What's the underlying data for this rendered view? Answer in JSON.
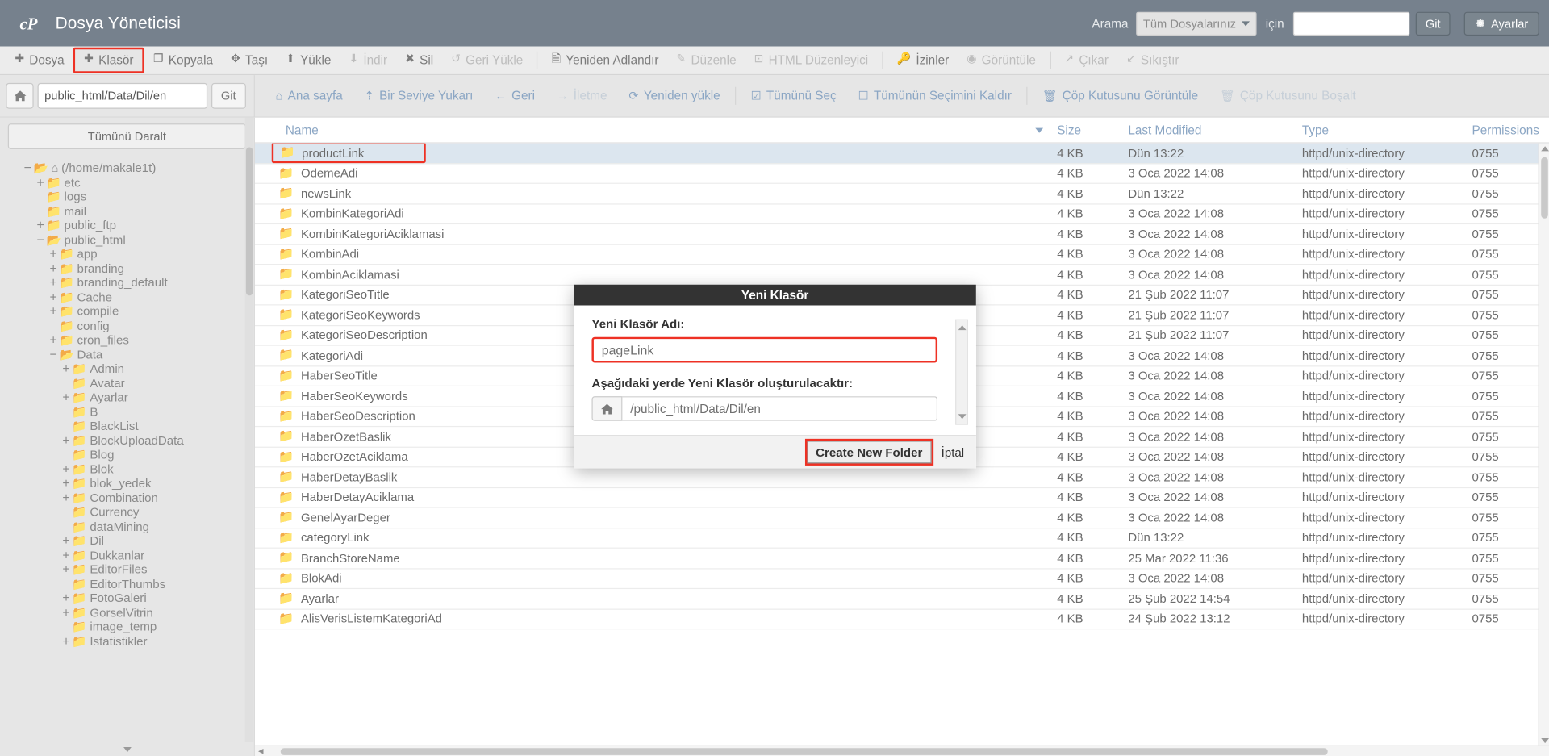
{
  "header": {
    "logo_icon": "cpanel-logo-icon",
    "title": "Dosya Yöneticisi",
    "search_label": "Arama",
    "search_scope_value": "Tüm Dosyalarınız",
    "search_for_label": "için",
    "search_input_value": "",
    "search_input_placeholder": "",
    "go_label": "Git",
    "settings_label": "Ayarlar",
    "settings_icon": "gear-icon"
  },
  "toolbar": [
    {
      "label": "Dosya",
      "icon": "plus-icon",
      "disabled": false,
      "highlight": false
    },
    {
      "label": "Klasör",
      "icon": "plus-icon",
      "disabled": false,
      "highlight": true
    },
    {
      "label": "Kopyala",
      "icon": "copy-icon",
      "disabled": false,
      "highlight": false
    },
    {
      "label": "Taşı",
      "icon": "move-icon",
      "disabled": false,
      "highlight": false
    },
    {
      "label": "Yükle",
      "icon": "upload-icon",
      "disabled": false,
      "highlight": false
    },
    {
      "label": "İndir",
      "icon": "download-icon",
      "disabled": true,
      "highlight": false
    },
    {
      "label": "Sil",
      "icon": "x-icon",
      "disabled": false,
      "highlight": false
    },
    {
      "label": "Geri Yükle",
      "icon": "undo-icon",
      "disabled": true,
      "highlight": false
    },
    {
      "label": "Yeniden Adlandır",
      "icon": "file-icon",
      "disabled": false,
      "highlight": false
    },
    {
      "label": "Düzenle",
      "icon": "pencil-icon",
      "disabled": true,
      "highlight": false
    },
    {
      "label": "HTML Düzenleyici",
      "icon": "code-icon",
      "disabled": true,
      "highlight": false
    },
    {
      "label": "İzinler",
      "icon": "key-icon",
      "disabled": false,
      "highlight": false
    },
    {
      "label": "Görüntüle",
      "icon": "eye-icon",
      "disabled": true,
      "highlight": false
    },
    {
      "label": "Çıkar",
      "icon": "extract-icon",
      "disabled": true,
      "highlight": false
    },
    {
      "label": "Sıkıştır",
      "icon": "compress-icon",
      "disabled": true,
      "highlight": false
    }
  ],
  "pathbar": {
    "home_icon": "home-icon",
    "path_value": "public_html/Data/Dil/en",
    "git_label": "Git"
  },
  "navbar": [
    {
      "label": "Ana sayfa",
      "icon": "home-icon",
      "dim": false
    },
    {
      "label": "Bir Seviye Yukarı",
      "icon": "up-arrow-icon",
      "dim": false
    },
    {
      "label": "Geri",
      "icon": "arrow-left-icon",
      "dim": false
    },
    {
      "label": "İletme",
      "icon": "arrow-right-icon",
      "dim": true
    },
    {
      "label": "Yeniden yükle",
      "icon": "refresh-icon",
      "dim": false
    },
    {
      "label": "Tümünü Seç",
      "icon": "checkbox-checked-icon",
      "dim": false
    },
    {
      "label": "Tümünün Seçimini Kaldır",
      "icon": "checkbox-empty-icon",
      "dim": false
    },
    {
      "label": "Çöp Kutusunu Görüntüle",
      "icon": "trash-icon",
      "dim": false
    },
    {
      "label": "Çöp Kutusunu Boşalt",
      "icon": "trash-icon",
      "dim": true
    }
  ],
  "sidebar": {
    "collapse_label": "Tümünü Daralt",
    "tree": [
      {
        "label": "(/home/makale1t)",
        "indent": 0,
        "toggle": "−",
        "icon": "folder-open-icon",
        "home": true
      },
      {
        "label": "etc",
        "indent": 1,
        "toggle": "+",
        "icon": "folder-icon"
      },
      {
        "label": "logs",
        "indent": 1,
        "toggle": "",
        "icon": "folder-icon"
      },
      {
        "label": "mail",
        "indent": 1,
        "toggle": "",
        "icon": "folder-icon"
      },
      {
        "label": "public_ftp",
        "indent": 1,
        "toggle": "+",
        "icon": "folder-icon"
      },
      {
        "label": "public_html",
        "indent": 1,
        "toggle": "−",
        "icon": "folder-open-icon"
      },
      {
        "label": "app",
        "indent": 2,
        "toggle": "+",
        "icon": "folder-icon"
      },
      {
        "label": "branding",
        "indent": 2,
        "toggle": "+",
        "icon": "folder-icon"
      },
      {
        "label": "branding_default",
        "indent": 2,
        "toggle": "+",
        "icon": "folder-icon"
      },
      {
        "label": "Cache",
        "indent": 2,
        "toggle": "+",
        "icon": "folder-icon"
      },
      {
        "label": "compile",
        "indent": 2,
        "toggle": "+",
        "icon": "folder-icon"
      },
      {
        "label": "config",
        "indent": 2,
        "toggle": "",
        "icon": "folder-icon"
      },
      {
        "label": "cron_files",
        "indent": 2,
        "toggle": "+",
        "icon": "folder-icon"
      },
      {
        "label": "Data",
        "indent": 2,
        "toggle": "−",
        "icon": "folder-open-icon"
      },
      {
        "label": "Admin",
        "indent": 3,
        "toggle": "+",
        "icon": "folder-icon"
      },
      {
        "label": "Avatar",
        "indent": 3,
        "toggle": "",
        "icon": "folder-icon"
      },
      {
        "label": "Ayarlar",
        "indent": 3,
        "toggle": "+",
        "icon": "folder-icon"
      },
      {
        "label": "B",
        "indent": 3,
        "toggle": "",
        "icon": "folder-icon"
      },
      {
        "label": "BlackList",
        "indent": 3,
        "toggle": "",
        "icon": "folder-icon"
      },
      {
        "label": "BlockUploadData",
        "indent": 3,
        "toggle": "+",
        "icon": "folder-icon"
      },
      {
        "label": "Blog",
        "indent": 3,
        "toggle": "",
        "icon": "folder-icon"
      },
      {
        "label": "Blok",
        "indent": 3,
        "toggle": "+",
        "icon": "folder-icon"
      },
      {
        "label": "blok_yedek",
        "indent": 3,
        "toggle": "+",
        "icon": "folder-icon"
      },
      {
        "label": "Combination",
        "indent": 3,
        "toggle": "+",
        "icon": "folder-icon"
      },
      {
        "label": "Currency",
        "indent": 3,
        "toggle": "",
        "icon": "folder-icon"
      },
      {
        "label": "dataMining",
        "indent": 3,
        "toggle": "",
        "icon": "folder-icon"
      },
      {
        "label": "Dil",
        "indent": 3,
        "toggle": "+",
        "icon": "folder-icon"
      },
      {
        "label": "Dukkanlar",
        "indent": 3,
        "toggle": "+",
        "icon": "folder-icon"
      },
      {
        "label": "EditorFiles",
        "indent": 3,
        "toggle": "+",
        "icon": "folder-icon"
      },
      {
        "label": "EditorThumbs",
        "indent": 3,
        "toggle": "",
        "icon": "folder-icon"
      },
      {
        "label": "FotoGaleri",
        "indent": 3,
        "toggle": "+",
        "icon": "folder-icon"
      },
      {
        "label": "GorselVitrin",
        "indent": 3,
        "toggle": "+",
        "icon": "folder-icon"
      },
      {
        "label": "image_temp",
        "indent": 3,
        "toggle": "",
        "icon": "folder-icon"
      },
      {
        "label": "Istatistikler",
        "indent": 3,
        "toggle": "+",
        "icon": "folder-icon"
      }
    ]
  },
  "filelist": {
    "columns": {
      "name": "Name",
      "size": "Size",
      "modified": "Last Modified",
      "type": "Type",
      "permissions": "Permissions"
    },
    "sort": {
      "column": "Name",
      "direction": "desc"
    },
    "rows": [
      {
        "name": "productLink",
        "size": "4 KB",
        "modified": "Dün 13:22",
        "type": "httpd/unix-directory",
        "permissions": "0755",
        "selected": true,
        "highlight": true
      },
      {
        "name": "OdemeAdi",
        "size": "4 KB",
        "modified": "3 Oca 2022 14:08",
        "type": "httpd/unix-directory",
        "permissions": "0755"
      },
      {
        "name": "newsLink",
        "size": "4 KB",
        "modified": "Dün 13:22",
        "type": "httpd/unix-directory",
        "permissions": "0755"
      },
      {
        "name": "KombinKategoriAdi",
        "size": "4 KB",
        "modified": "3 Oca 2022 14:08",
        "type": "httpd/unix-directory",
        "permissions": "0755"
      },
      {
        "name": "KombinKategoriAciklamasi",
        "size": "4 KB",
        "modified": "3 Oca 2022 14:08",
        "type": "httpd/unix-directory",
        "permissions": "0755"
      },
      {
        "name": "KombinAdi",
        "size": "4 KB",
        "modified": "3 Oca 2022 14:08",
        "type": "httpd/unix-directory",
        "permissions": "0755"
      },
      {
        "name": "KombinAciklamasi",
        "size": "4 KB",
        "modified": "3 Oca 2022 14:08",
        "type": "httpd/unix-directory",
        "permissions": "0755"
      },
      {
        "name": "KategoriSeoTitle",
        "size": "4 KB",
        "modified": "21 Şub 2022 11:07",
        "type": "httpd/unix-directory",
        "permissions": "0755"
      },
      {
        "name": "KategoriSeoKeywords",
        "size": "4 KB",
        "modified": "21 Şub 2022 11:07",
        "type": "httpd/unix-directory",
        "permissions": "0755"
      },
      {
        "name": "KategoriSeoDescription",
        "size": "4 KB",
        "modified": "21 Şub 2022 11:07",
        "type": "httpd/unix-directory",
        "permissions": "0755"
      },
      {
        "name": "KategoriAdi",
        "size": "4 KB",
        "modified": "3 Oca 2022 14:08",
        "type": "httpd/unix-directory",
        "permissions": "0755"
      },
      {
        "name": "HaberSeoTitle",
        "size": "4 KB",
        "modified": "3 Oca 2022 14:08",
        "type": "httpd/unix-directory",
        "permissions": "0755"
      },
      {
        "name": "HaberSeoKeywords",
        "size": "4 KB",
        "modified": "3 Oca 2022 14:08",
        "type": "httpd/unix-directory",
        "permissions": "0755"
      },
      {
        "name": "HaberSeoDescription",
        "size": "4 KB",
        "modified": "3 Oca 2022 14:08",
        "type": "httpd/unix-directory",
        "permissions": "0755"
      },
      {
        "name": "HaberOzetBaslik",
        "size": "4 KB",
        "modified": "3 Oca 2022 14:08",
        "type": "httpd/unix-directory",
        "permissions": "0755"
      },
      {
        "name": "HaberOzetAciklama",
        "size": "4 KB",
        "modified": "3 Oca 2022 14:08",
        "type": "httpd/unix-directory",
        "permissions": "0755"
      },
      {
        "name": "HaberDetayBaslik",
        "size": "4 KB",
        "modified": "3 Oca 2022 14:08",
        "type": "httpd/unix-directory",
        "permissions": "0755"
      },
      {
        "name": "HaberDetayAciklama",
        "size": "4 KB",
        "modified": "3 Oca 2022 14:08",
        "type": "httpd/unix-directory",
        "permissions": "0755"
      },
      {
        "name": "GenelAyarDeger",
        "size": "4 KB",
        "modified": "3 Oca 2022 14:08",
        "type": "httpd/unix-directory",
        "permissions": "0755"
      },
      {
        "name": "categoryLink",
        "size": "4 KB",
        "modified": "Dün 13:22",
        "type": "httpd/unix-directory",
        "permissions": "0755"
      },
      {
        "name": "BranchStoreName",
        "size": "4 KB",
        "modified": "25 Mar 2022 11:36",
        "type": "httpd/unix-directory",
        "permissions": "0755"
      },
      {
        "name": "BlokAdi",
        "size": "4 KB",
        "modified": "3 Oca 2022 14:08",
        "type": "httpd/unix-directory",
        "permissions": "0755"
      },
      {
        "name": "Ayarlar",
        "size": "4 KB",
        "modified": "25 Şub 2022 14:54",
        "type": "httpd/unix-directory",
        "permissions": "0755"
      },
      {
        "name": "AlisVerisListemKategoriAd",
        "size": "4 KB",
        "modified": "24 Şub 2022 13:12",
        "type": "httpd/unix-directory",
        "permissions": "0755"
      }
    ]
  },
  "modal": {
    "title": "Yeni Klasör",
    "name_label": "Yeni Klasör Adı:",
    "name_value": "pageLink",
    "location_label": "Aşağıdaki yerde Yeni Klasör oluşturulacaktır:",
    "location_home_icon": "home-icon",
    "location_value": "/public_html/Data/Dil/en",
    "create_label": "Create New Folder",
    "cancel_label": "İptal"
  },
  "colors": {
    "header_bg": "#76818d",
    "accent_red": "#ee3124",
    "link_blue": "#8ba6c4",
    "folder": "#ddc39a",
    "selected_row": "#dce6ef"
  }
}
